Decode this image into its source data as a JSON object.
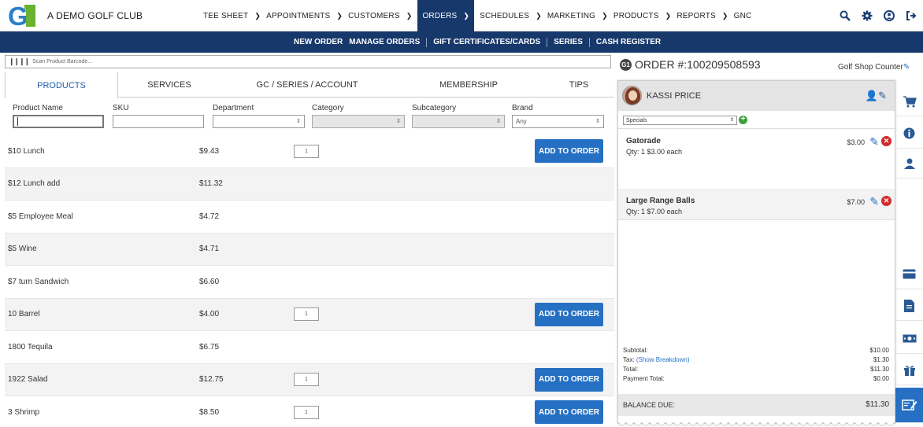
{
  "header": {
    "club_name": "A DEMO GOLF CLUB",
    "logo_text": "G1",
    "menu": [
      {
        "label": "TEE SHEET",
        "has_dropdown": true
      },
      {
        "label": "APPOINTMENTS",
        "has_dropdown": true
      },
      {
        "label": "CUSTOMERS",
        "has_dropdown": true
      },
      {
        "label": "ORDERS",
        "has_dropdown": true,
        "active": true
      },
      {
        "label": "SCHEDULES",
        "has_dropdown": true
      },
      {
        "label": "MARKETING",
        "has_dropdown": true
      },
      {
        "label": "PRODUCTS",
        "has_dropdown": true
      },
      {
        "label": "REPORTS",
        "has_dropdown": true
      },
      {
        "label": "GNC",
        "has_dropdown": false
      }
    ],
    "icons": [
      "search-icon",
      "gear-icon",
      "user-icon",
      "logout-icon"
    ]
  },
  "subnav": {
    "items": [
      "NEW ORDER",
      "MANAGE ORDERS",
      "GIFT CERTIFICATES/CARDS",
      "SERIES",
      "CASH REGISTER"
    ]
  },
  "barcode": {
    "placeholder": "Scan Product Barcode..."
  },
  "tabs": [
    "PRODUCTS",
    "SERVICES",
    "GC / SERIES / ACCOUNT",
    "MEMBERSHIP",
    "TIPS"
  ],
  "filters": {
    "product_name": "Product Name",
    "sku": "SKU",
    "department": "Department",
    "category": "Category",
    "subcategory": "Subcategory",
    "brand": "Brand",
    "brand_value": "Any"
  },
  "products": [
    {
      "name": "$10 Lunch",
      "price": "$9.43",
      "qty": "1",
      "add": "ADD TO ORDER"
    },
    {
      "name": "$12 Lunch add",
      "price": "$11.32",
      "qty": null,
      "add": null
    },
    {
      "name": "$5 Employee Meal",
      "price": "$4.72",
      "qty": null,
      "add": null
    },
    {
      "name": "$5 Wine",
      "price": "$4.71",
      "qty": null,
      "add": null
    },
    {
      "name": "$7 turn Sandwich",
      "price": "$6.60",
      "qty": null,
      "add": null
    },
    {
      "name": "10 Barrel",
      "price": "$4.00",
      "qty": "1",
      "add": "ADD TO ORDER"
    },
    {
      "name": "1800 Tequila",
      "price": "$6.75",
      "qty": null,
      "add": null
    },
    {
      "name": "1922 Salad",
      "price": "$12.75",
      "qty": "1",
      "add": "ADD TO ORDER"
    },
    {
      "name": "3 Shrimp",
      "price": "$8.50",
      "qty": "1",
      "add": "ADD TO ORDER"
    }
  ],
  "order": {
    "icon_text": "G1",
    "title": "ORDER #:100209508593",
    "location": "Golf Shop Counter",
    "customer": "KASSI PRICE",
    "specials": "Specials",
    "items": [
      {
        "name": "Gatorade",
        "detail": "Qty: 1   $3.00 each",
        "price": "$3.00"
      },
      {
        "name": "Large Range Balls",
        "detail": "Qty: 1   $7.00 each",
        "price": "$7.00"
      }
    ],
    "totals": {
      "subtotal_label": "Subtotal:",
      "subtotal": "$10.00",
      "tax_label": "Tax:",
      "tax_link": "(Show Breakdown)",
      "tax": "$1.30",
      "total_label": "Total:",
      "total": "$11.30",
      "payment_label": "Payment Total:",
      "payment": "$0.00",
      "balance_label": "BALANCE DUE:",
      "balance": "$11.30"
    }
  },
  "rail_icons": [
    "cart-icon",
    "info-icon",
    "user-icon",
    "credit-card-icon",
    "document-icon",
    "cash-icon",
    "gift-icon",
    "edit-order-icon"
  ],
  "colors": {
    "navy": "#17386b",
    "accent_blue": "#2670c3",
    "delete_red": "#d12b2b",
    "add_green": "#3aa33a"
  }
}
